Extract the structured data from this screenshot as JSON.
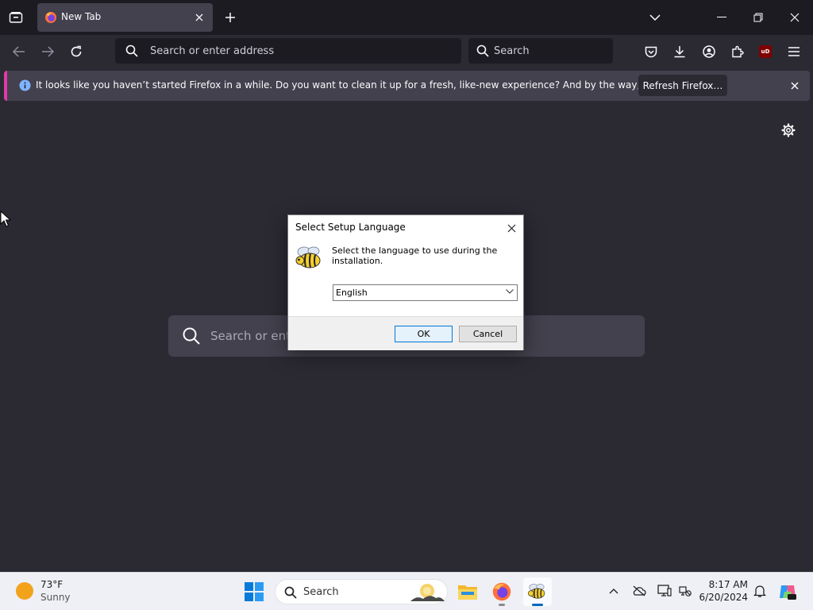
{
  "browser": {
    "tab": {
      "title": "New Tab"
    },
    "url_placeholder": "Search or enter address",
    "search_placeholder": "Search",
    "extension_badge": "uD"
  },
  "notification": {
    "message": "It looks like you haven’t started Firefox in a while. Do you want to clean it up for a fresh, like-new experience? And by the way, welcome back!",
    "button_label": "Refresh Firefox…",
    "accent_color": "#e23aa8"
  },
  "newtab": {
    "search_placeholder": "Search or ente"
  },
  "dialog": {
    "title": "Select Setup Language",
    "message": "Select the language to use during the installation.",
    "selected_language": "English",
    "ok_label": "OK",
    "cancel_label": "Cancel",
    "icon": "bee-icon"
  },
  "taskbar": {
    "weather": {
      "temp": "73°F",
      "condition": "Sunny"
    },
    "search_placeholder": "Search",
    "clock": {
      "time": "8:17 AM",
      "date": "6/20/2024"
    },
    "pinned_apps": [
      "file-explorer-icon",
      "firefox-icon",
      "setup-bee-icon"
    ]
  },
  "colors": {
    "tabstrip": "#1c1b22",
    "toolbar": "#2b2a33",
    "tab_selected": "#42414d",
    "dialog_ok_border": "#0078d7",
    "taskbar": "#eef0f5"
  }
}
